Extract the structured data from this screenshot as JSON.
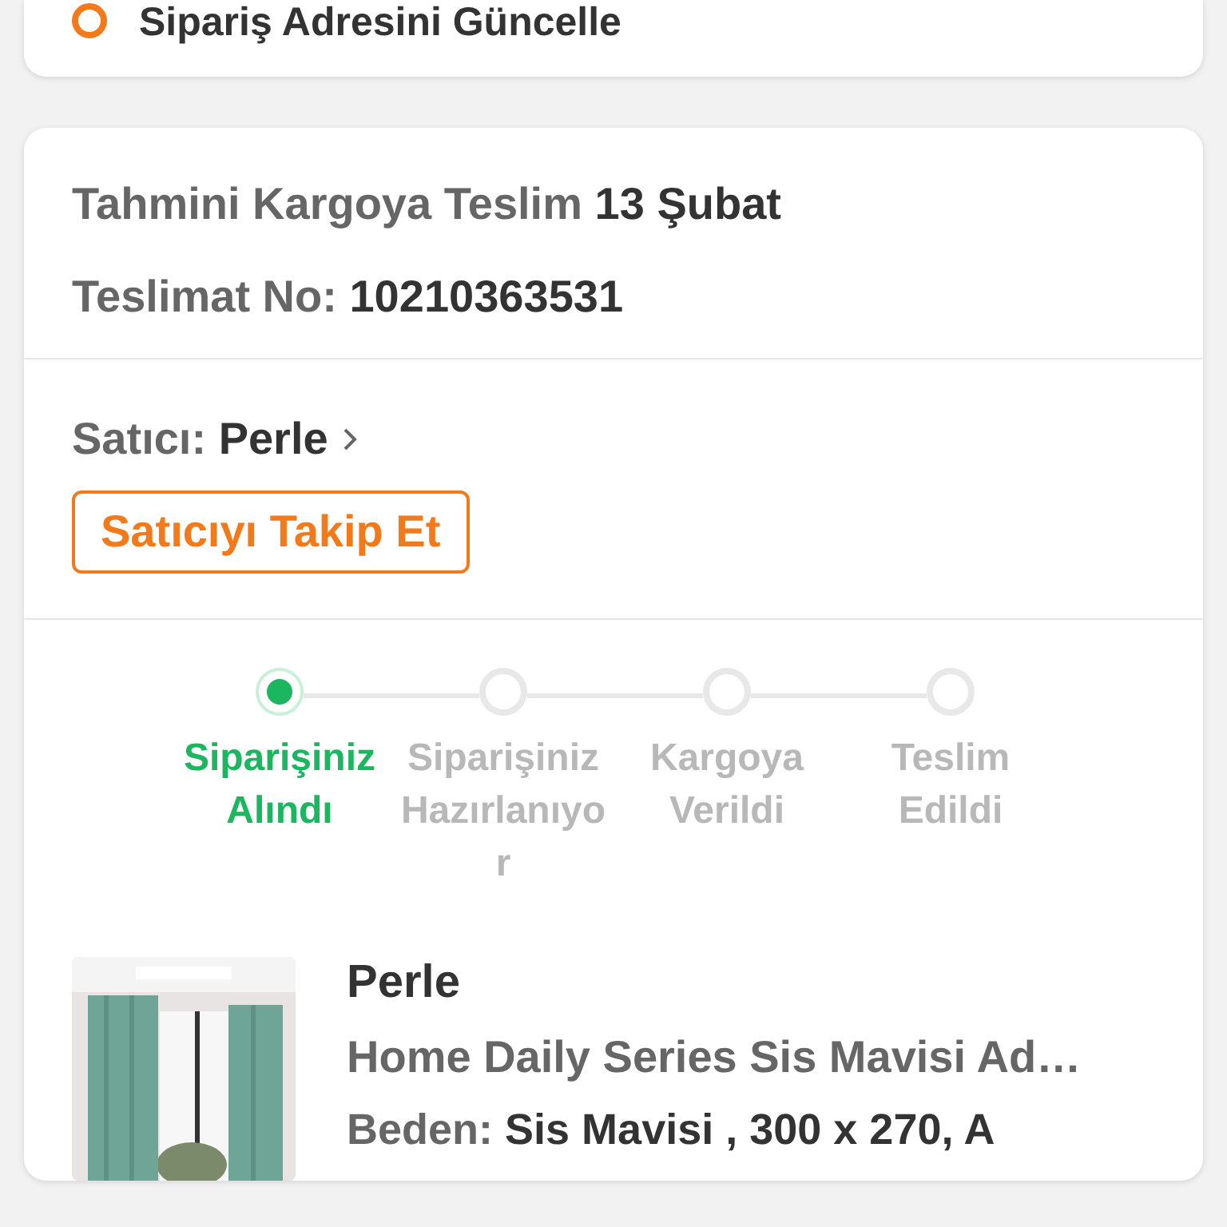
{
  "address_card": {
    "label": "Sipariş Adresini Güncelle"
  },
  "delivery": {
    "estimate_label": "Tahmini Kargoya Teslim",
    "estimate_date": "13 Şubat",
    "number_label": "Teslimat No:",
    "number": "10210363531"
  },
  "seller": {
    "label": "Satıcı:",
    "name": "Perle",
    "follow_button": "Satıcıyı Takip Et"
  },
  "steps": [
    {
      "label": "Siparişiniz Alındı",
      "active": true
    },
    {
      "label": "Siparişiniz Hazırlanıyor",
      "active": false
    },
    {
      "label": "Kargoya Verildi",
      "active": false
    },
    {
      "label": "Teslim Edildi",
      "active": false
    }
  ],
  "product": {
    "kind": "picture",
    "brand": "Perle",
    "title": "Home Daily Series Sis Mavisi Ad…",
    "variant_label": "Beden:",
    "variant": "Sis Mavisi , 300 x 270, A"
  }
}
